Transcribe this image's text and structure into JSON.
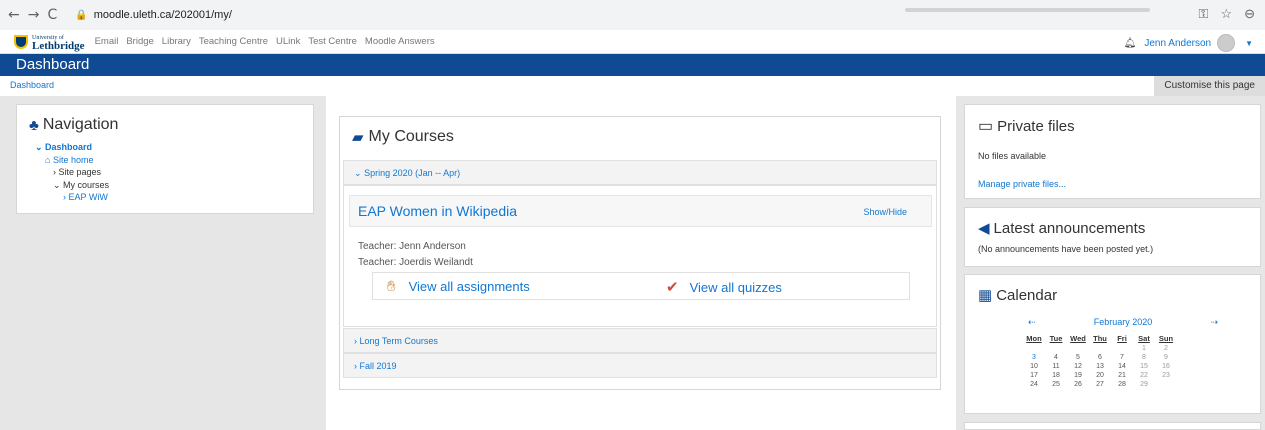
{
  "browser": {
    "url": "moodle.uleth.ca/202001/my/"
  },
  "topbar": {
    "logo_small": "University of",
    "logo_big": "Lethbridge",
    "links": [
      "Email",
      "Bridge",
      "Library",
      "Teaching Centre",
      "ULink",
      "Test Centre",
      "Moodle Answers"
    ],
    "user_name": "Jenn Anderson"
  },
  "header": {
    "title": "Dashboard",
    "breadcrumb": "Dashboard",
    "customise_label": "Customise this page"
  },
  "navigation": {
    "title": "Navigation",
    "dashboard": "Dashboard",
    "site_home": "Site home",
    "site_pages": "Site pages",
    "my_courses": "My courses",
    "course": "EAP WiW"
  },
  "my_courses": {
    "title": "My Courses",
    "term_open": "Spring 2020 (Jan -- Apr)",
    "course_title": "EAP Women in Wikipedia",
    "show_hide": "Show/Hide",
    "teacher1": "Teacher: Jenn Anderson",
    "teacher2": "Teacher: Joerdis Weilandt",
    "assignments": "View all assignments",
    "quizzes": "View all quizzes",
    "term_long": "Long Term Courses",
    "term_fall": "Fall 2019"
  },
  "private_files": {
    "title": "Private files",
    "empty": "No files available",
    "manage": "Manage private files..."
  },
  "announcements": {
    "title": "Latest announcements",
    "empty": "(No announcements have been posted yet.)"
  },
  "calendar": {
    "title": "Calendar",
    "month": "February 2020",
    "days": [
      "Mon",
      "Tue",
      "Wed",
      "Thu",
      "Fri",
      "Sat",
      "Sun"
    ],
    "weeks": [
      [
        "",
        "",
        "",
        "",
        "",
        "1",
        "2"
      ],
      [
        "3",
        "4",
        "5",
        "6",
        "7",
        "8",
        "9"
      ],
      [
        "10",
        "11",
        "12",
        "13",
        "14",
        "15",
        "16"
      ],
      [
        "17",
        "18",
        "19",
        "20",
        "21",
        "22",
        "23"
      ],
      [
        "24",
        "25",
        "26",
        "27",
        "28",
        "29",
        ""
      ]
    ]
  },
  "colors": {
    "brand": "#0f4a92",
    "link": "#1177d1"
  }
}
